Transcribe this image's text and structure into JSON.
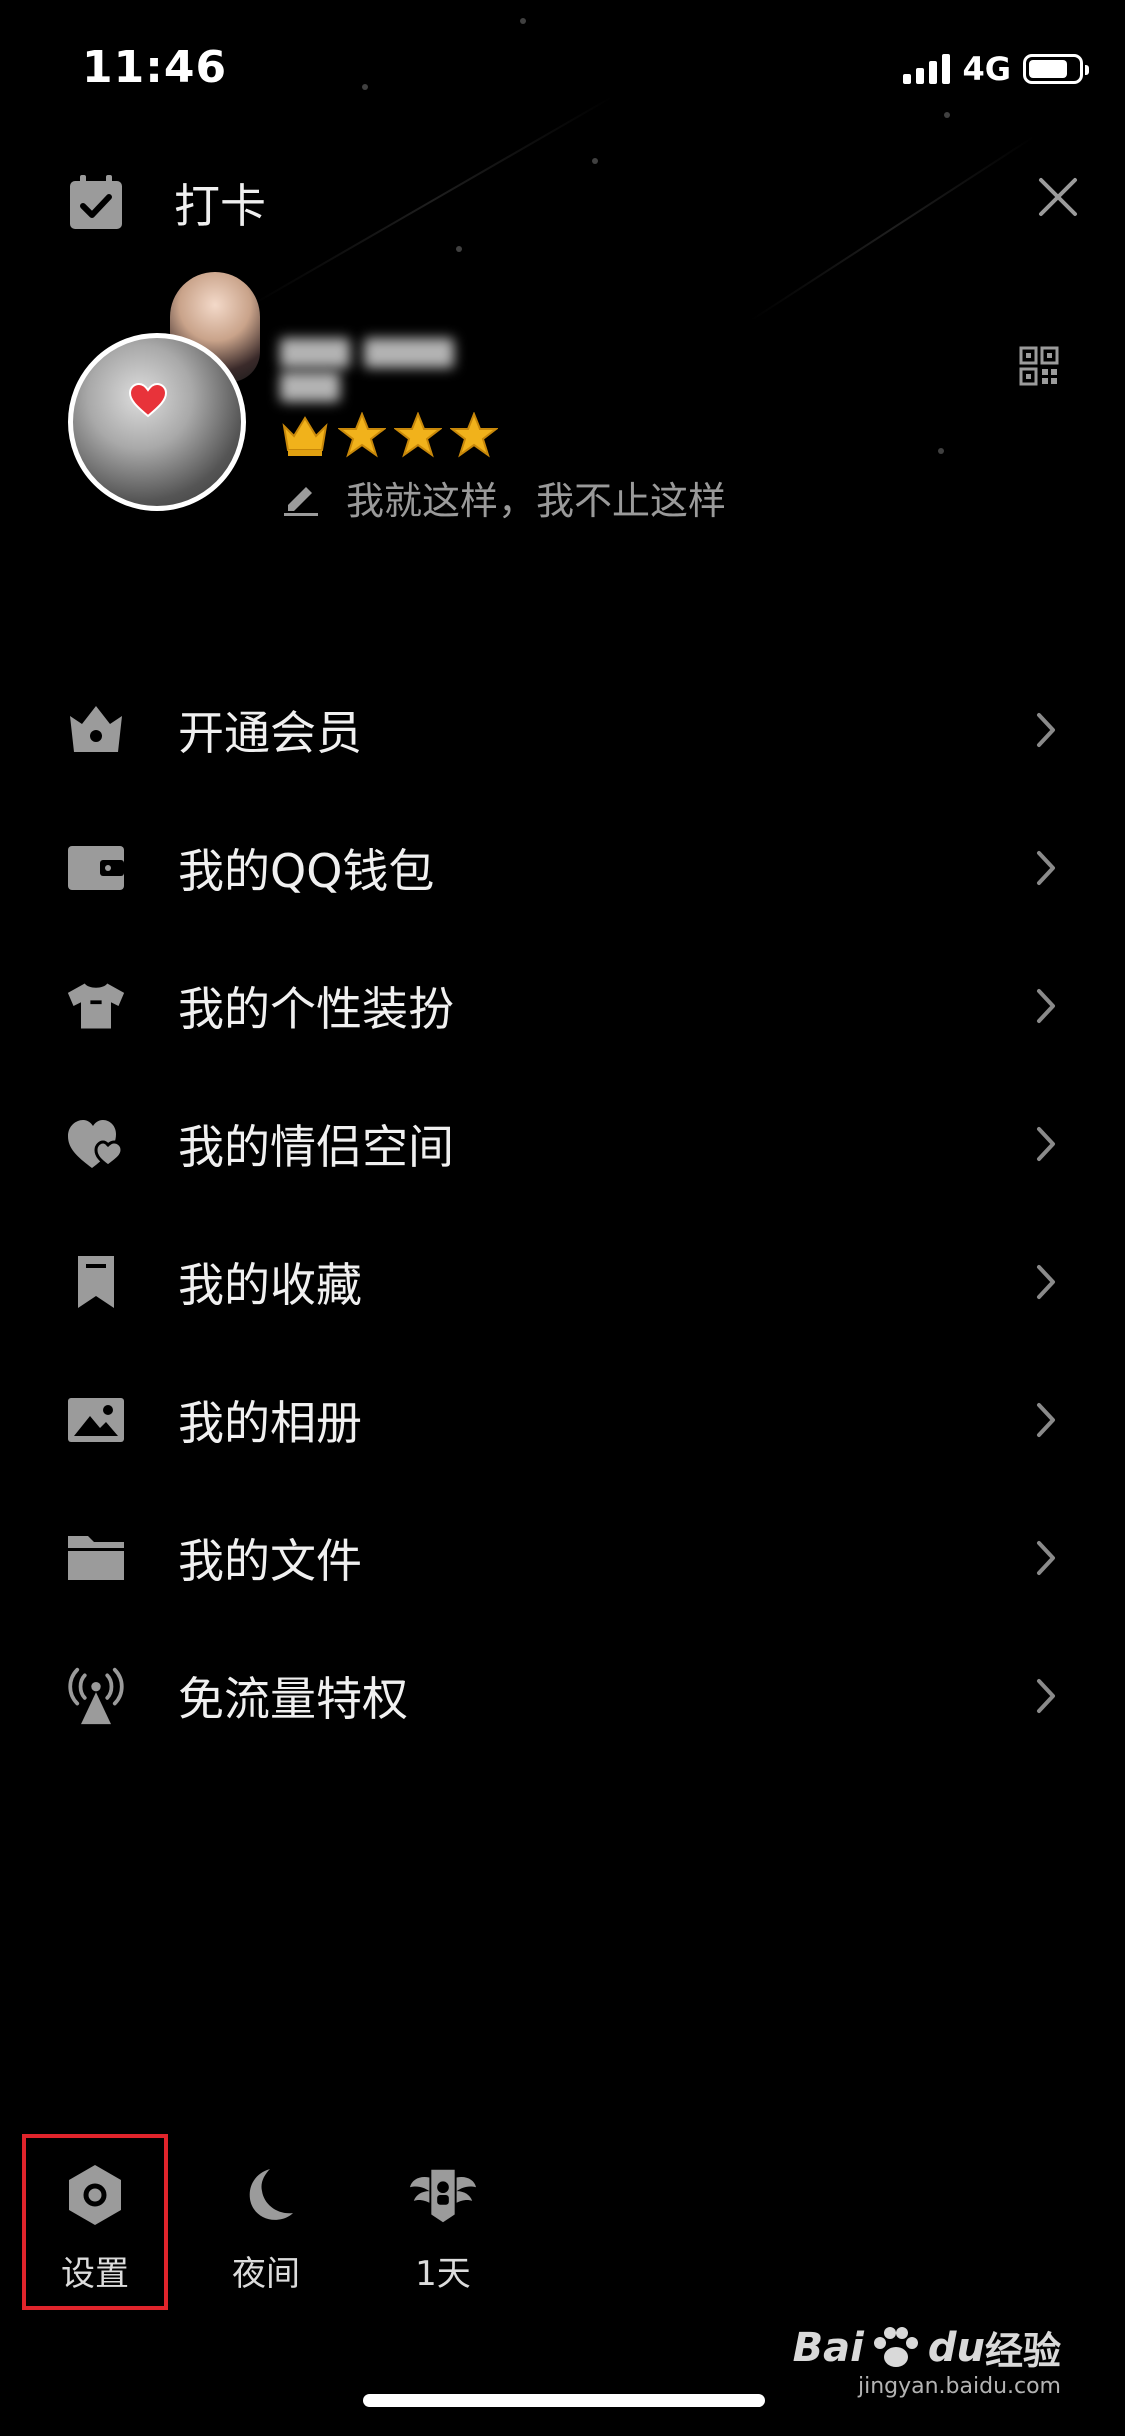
{
  "status_bar": {
    "time": "11:46",
    "network": "4G",
    "battery_level": 0.8
  },
  "header": {
    "title": "打卡",
    "close_icon": "close-icon",
    "calendar_icon": "calendar-check-icon"
  },
  "profile": {
    "signature": "我就这样，我不止这样",
    "level_icons": [
      "crown",
      "star",
      "star",
      "star"
    ]
  },
  "menu": {
    "items": [
      {
        "label": "开通会员",
        "icon": "vip-icon"
      },
      {
        "label": "我的QQ钱包",
        "icon": "wallet-icon"
      },
      {
        "label": "我的个性装扮",
        "icon": "tshirt-icon"
      },
      {
        "label": "我的情侣空间",
        "icon": "couple-heart-icon"
      },
      {
        "label": "我的收藏",
        "icon": "bookmark-icon"
      },
      {
        "label": "我的相册",
        "icon": "photo-icon"
      },
      {
        "label": "我的文件",
        "icon": "folder-icon"
      },
      {
        "label": "免流量特权",
        "icon": "signal-tower-icon"
      }
    ]
  },
  "bottom_bar": {
    "settings": "设置",
    "night": "夜间",
    "days": "1天"
  },
  "watermark": {
    "brand": "Bai",
    "brand2": "du",
    "suffix": "经验",
    "url": "jingyan.baidu.com"
  },
  "colors": {
    "background": "#000000",
    "text": "#f0f0f0",
    "icon": "#9b9b9b",
    "highlight": "#e0242b",
    "star": "#f1b21b"
  }
}
